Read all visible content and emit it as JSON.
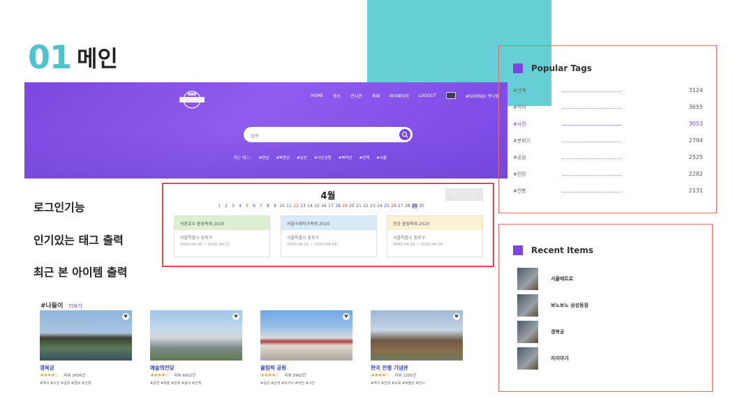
{
  "slide": {
    "number": "01",
    "title": "메인"
  },
  "header": {
    "nav": [
      "HOME",
      "명소",
      "전시관",
      "축제",
      "마이페이지",
      "LOGOUT",
      "#GOONJU 쿠니영"
    ],
    "search_placeholder": "검색",
    "hot_tags": [
      "최근 태그 :",
      "#연남",
      "#북한산",
      "#남산",
      "#낙산공원",
      "#북악산",
      "#산책",
      "#서울"
    ]
  },
  "features": [
    "로그인기능",
    "인기있는 태그 출력",
    "최근 본 아이템 출력"
  ],
  "calendar": {
    "month": "4월",
    "pager": [
      "<",
      ">"
    ],
    "days": [
      "1",
      "2",
      "3",
      "4",
      "5",
      "6",
      "7",
      "8",
      "9",
      "10",
      "11",
      "12",
      "13",
      "14",
      "15",
      "16",
      "17",
      "18",
      "19",
      "20",
      "21",
      "22",
      "23",
      "24",
      "25",
      "26",
      "27",
      "28",
      "29",
      "30"
    ],
    "red_days": [
      "5",
      "12",
      "19",
      "26"
    ],
    "blue_days": [
      "4",
      "11",
      "18",
      "25"
    ],
    "selected_day": "29",
    "events": [
      {
        "title": "석촌호수 봄꽃축제 2020",
        "location": "서울특별시 송파구",
        "dates": "2020.04.03 ~ 2020.04.12",
        "color": "#dcefd0"
      },
      {
        "title": "서울국제작가축제 2020",
        "location": "서울특별시 종로구",
        "dates": "2020.04.21 ~ 2020.04.29",
        "color": "#d6eaf7"
      },
      {
        "title": "한강 불빛축제 2020",
        "location": "서울특별시 종로구",
        "dates": "2020.04.28 ~ 2020.04.29",
        "color": "#fbf2d4"
      }
    ]
  },
  "popular_tags": {
    "title": "Popular Tags",
    "items": [
      {
        "tag": "#산책",
        "count": "3124"
      },
      {
        "tag": "#역사",
        "count": "3655"
      },
      {
        "tag": "#사진",
        "count": "3053",
        "highlight": true
      },
      {
        "tag": "#분위기",
        "count": "2794"
      },
      {
        "tag": "#공원",
        "count": "2525"
      },
      {
        "tag": "#전망",
        "count": "2282"
      },
      {
        "tag": "#전통",
        "count": "2131"
      }
    ]
  },
  "recent_items": {
    "title": "Recent Items",
    "items": [
      "서울메트로",
      "보노보노 삼성동점",
      "경복궁",
      "자이아기"
    ]
  },
  "section": {
    "title": "#나들이",
    "more": "더보기"
  },
  "cards": [
    {
      "name": "경복궁",
      "stars": "★★★★☆",
      "reviews": "리뷰 3006건",
      "tags": "#역사 #사진 #궁궐 #경복 #산책",
      "img": "img1"
    },
    {
      "name": "예술의전당",
      "stars": "★★★★☆",
      "reviews": "리뷰 6002건",
      "tags": "#공연 #예술 #문화 #음악 #산책",
      "img": "img2"
    },
    {
      "name": "올림픽 공원",
      "stars": "★★★★☆",
      "reviews": "리뷰 3962건",
      "tags": "#공원 #산책 #피크닉 #자연 #사진",
      "img": "img3"
    },
    {
      "name": "한국 전쟁 기념관",
      "stars": "★★★★☆",
      "reviews": "리뷰 1255건",
      "tags": "#역사 #전쟁 #교육 #박물관 #전시",
      "img": "img4"
    }
  ]
}
